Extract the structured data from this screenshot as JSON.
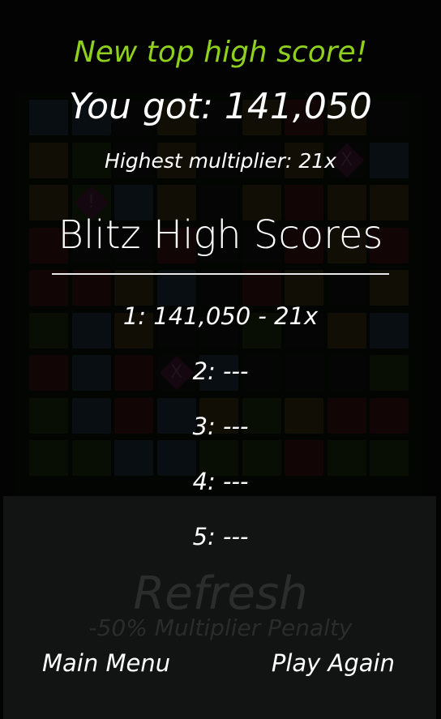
{
  "game": {
    "headline": "New top high score!",
    "score_text": "You got: 141,050",
    "highest_multiplier_text": "Highest multiplier: 21x"
  },
  "high_scores": {
    "title": "Blitz High Scores",
    "entries": [
      "1: 141,050 - 21x",
      "2: ---",
      "3: ---",
      "4: ---",
      "5: ---"
    ]
  },
  "refresh": {
    "label": "Refresh",
    "penalty": "-50% Multiplier Penalty"
  },
  "buttons": {
    "main_menu": "Main Menu",
    "play_again": "Play Again"
  },
  "board": {
    "tile_colors": {
      "B": "#1e3342",
      "O": "#3f3413",
      "G": "#203211",
      "R": "#3f1214",
      "K": "#101510"
    },
    "rows": [
      "BBKOKOROK",
      "OGKOKKOKB",
      "OGBOKOROO",
      "RKKRKKROR",
      "RROBKROKO",
      "GBOKKGKOB",
      "RBRKBKKKG",
      "GBRBOGORR",
      "GGBBGGRGG"
    ],
    "gems": [
      {
        "icon": "exclamation-gem",
        "glyph": "!",
        "row": 2,
        "col": 1
      },
      {
        "icon": "x-gem",
        "glyph": "X",
        "row": 1,
        "col": 7
      },
      {
        "icon": "x-gem",
        "glyph": "X",
        "row": 6,
        "col": 3
      }
    ]
  }
}
